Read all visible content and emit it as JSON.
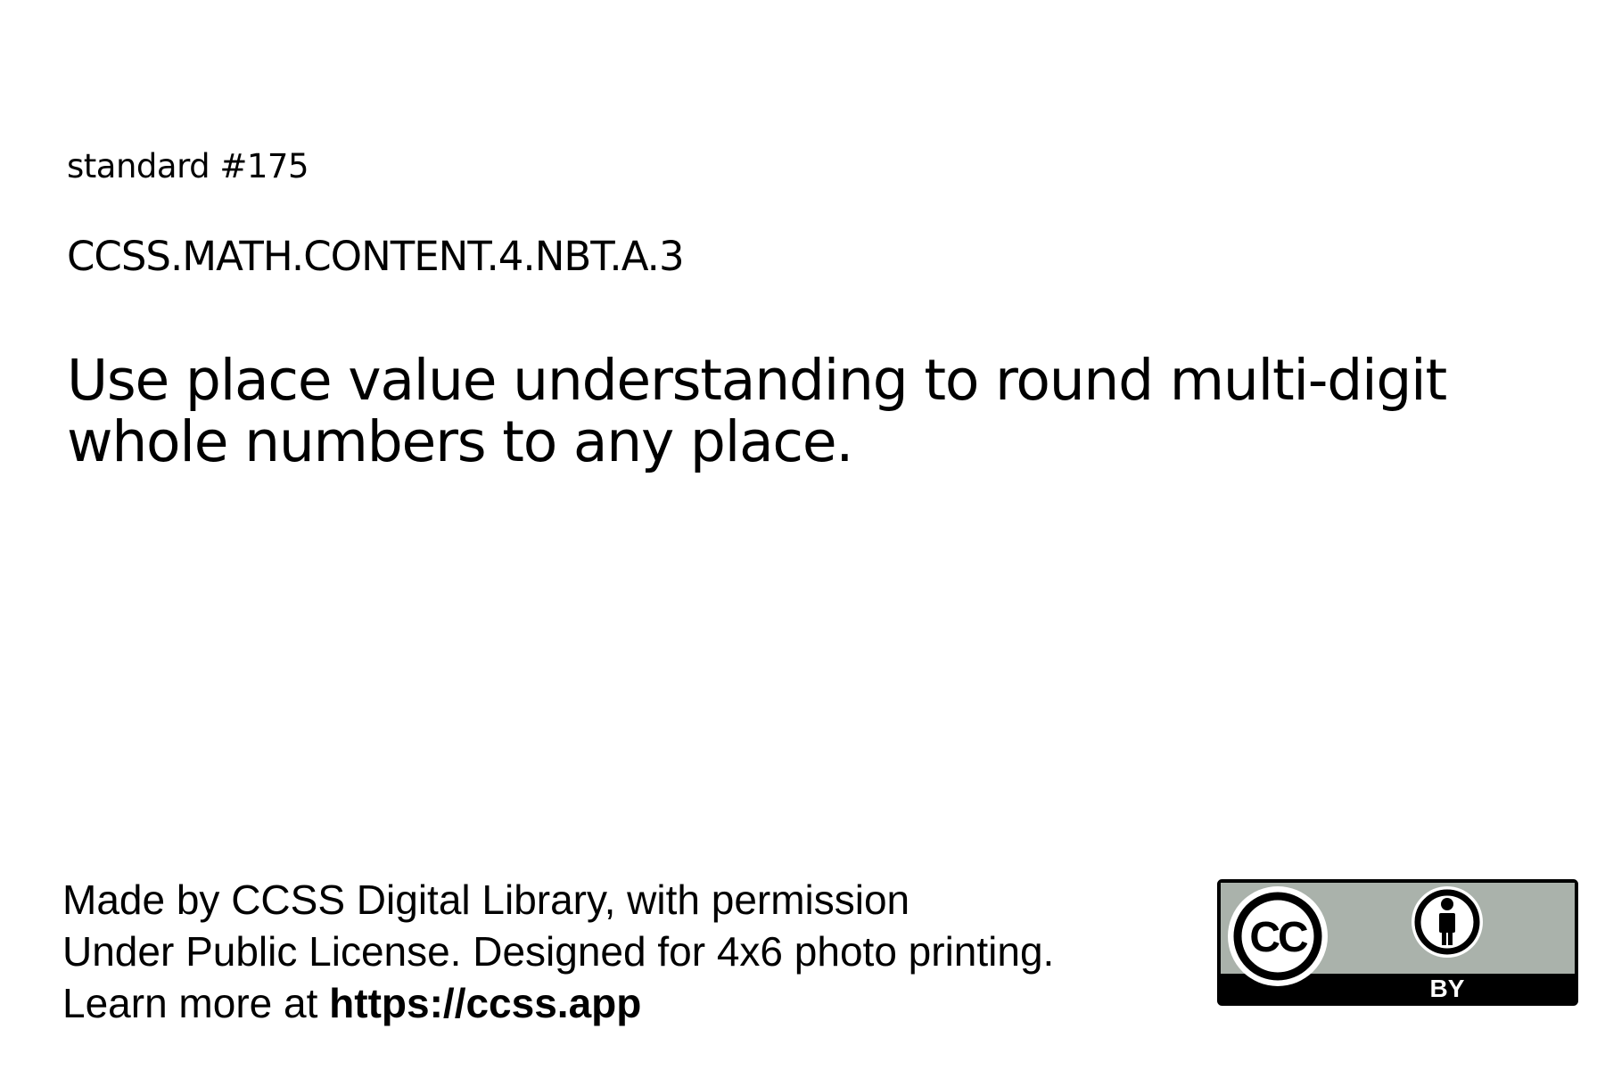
{
  "standard": {
    "number_label": "standard #175",
    "code": "CCSS.MATH.CONTENT.4.NBT.A.3",
    "description": "Use place value understanding to round multi-digit whole numbers to any place."
  },
  "footer": {
    "line1": "Made by CCSS Digital Library, with permission",
    "line2": "Under Public License. Designed for 4x6 photo printing.",
    "line3_prefix": "Learn more at ",
    "link": "https://ccss.app"
  },
  "license_badge": {
    "cc_text": "CC",
    "by_text": "BY",
    "icon": "attribution-person-icon",
    "colors": {
      "background": "#aab2ab",
      "bar": "#000000",
      "text_light": "#ffffff"
    }
  }
}
